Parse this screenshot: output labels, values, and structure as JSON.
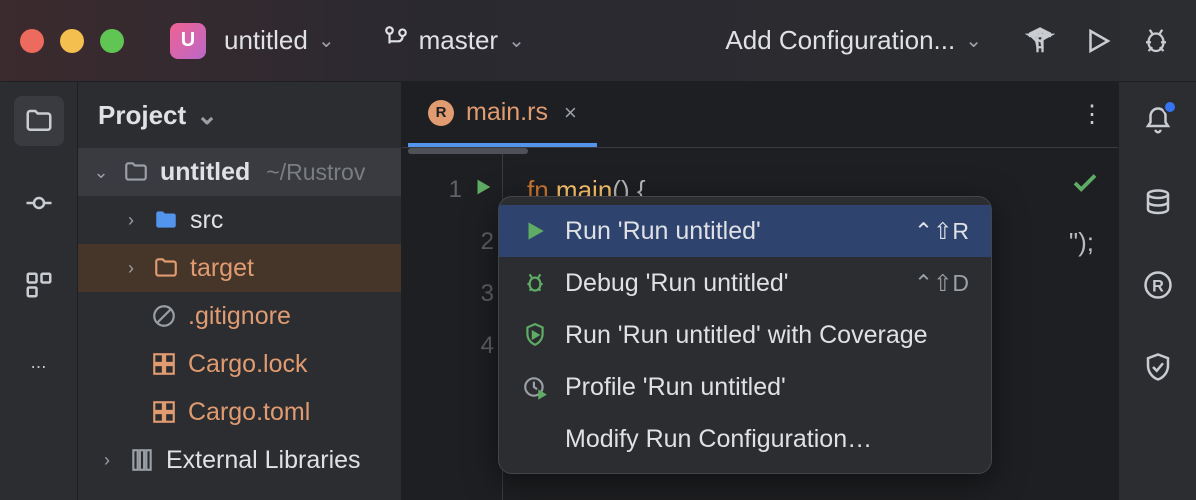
{
  "titlebar": {
    "project_letter": "U",
    "project_name": "untitled",
    "branch": "master",
    "run_config": "Add Configuration..."
  },
  "project_panel": {
    "title": "Project",
    "root": {
      "name": "untitled",
      "path": "~/Rustrov"
    },
    "items": [
      {
        "name": "src"
      },
      {
        "name": "target"
      },
      {
        "name": ".gitignore"
      },
      {
        "name": "Cargo.lock"
      },
      {
        "name": "Cargo.toml"
      }
    ],
    "external_libs": "External Libraries"
  },
  "editor": {
    "tab_name": "main.rs",
    "lines": [
      "1",
      "2",
      "3",
      "4"
    ],
    "code": {
      "l1_kw": "fn ",
      "l1_fn": "main",
      "l1_rest": "() {",
      "l2_end": "\");"
    }
  },
  "context_menu": {
    "items": [
      {
        "label": "Run 'Run untitled'",
        "shortcut": "⌃⇧R"
      },
      {
        "label": "Debug 'Run untitled'",
        "shortcut": "⌃⇧D"
      },
      {
        "label": "Run 'Run untitled' with Coverage",
        "shortcut": ""
      },
      {
        "label": "Profile 'Run untitled'",
        "shortcut": ""
      },
      {
        "label": "Modify Run Configuration…",
        "shortcut": ""
      }
    ]
  }
}
